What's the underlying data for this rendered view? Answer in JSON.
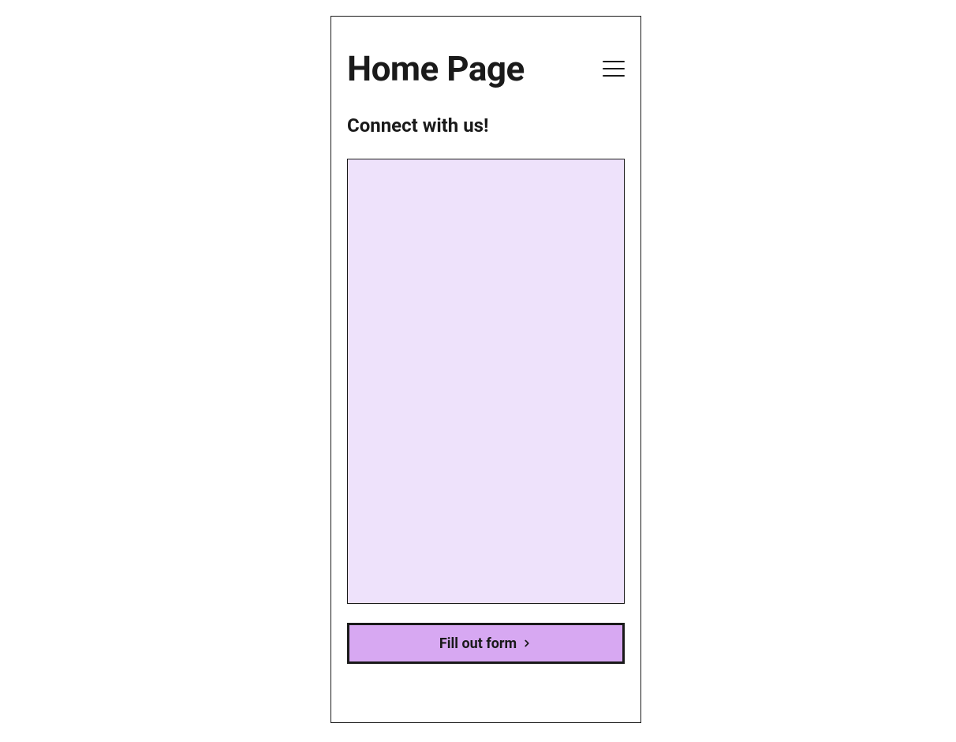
{
  "header": {
    "title": "Home Page"
  },
  "subtitle": "Connect with us!",
  "cta": {
    "label": "Fill out form"
  },
  "colors": {
    "image_bg": "#EEE2FB",
    "button_bg": "#D7A8F2",
    "border": "#1a1a1a"
  }
}
